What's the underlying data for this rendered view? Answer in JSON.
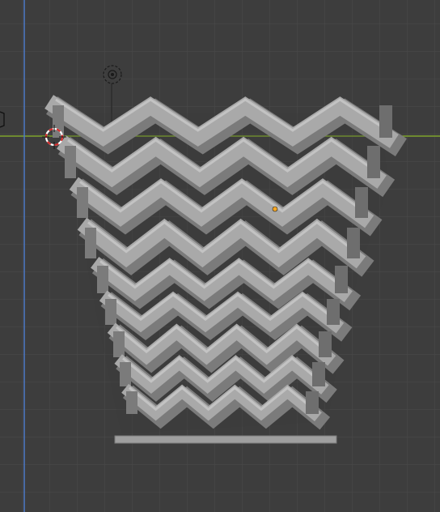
{
  "viewport": {
    "background": "#3d3d3d",
    "grid_color": "#4a4a4a",
    "x_axis_color": "#7fa32d",
    "y_axis_color": "#4d79c7"
  },
  "model": {
    "shape": "hexagonal-mesh-vase",
    "base_color": "#a9a9a9",
    "side_shade": "#7b7b7b",
    "top_shade": "#c3c3c3"
  },
  "overlays": {
    "light_icon": "light-icon",
    "camera_icon": "camera-icon",
    "cursor_icon": "3d-cursor-icon",
    "origin_color": "#f5a623"
  }
}
